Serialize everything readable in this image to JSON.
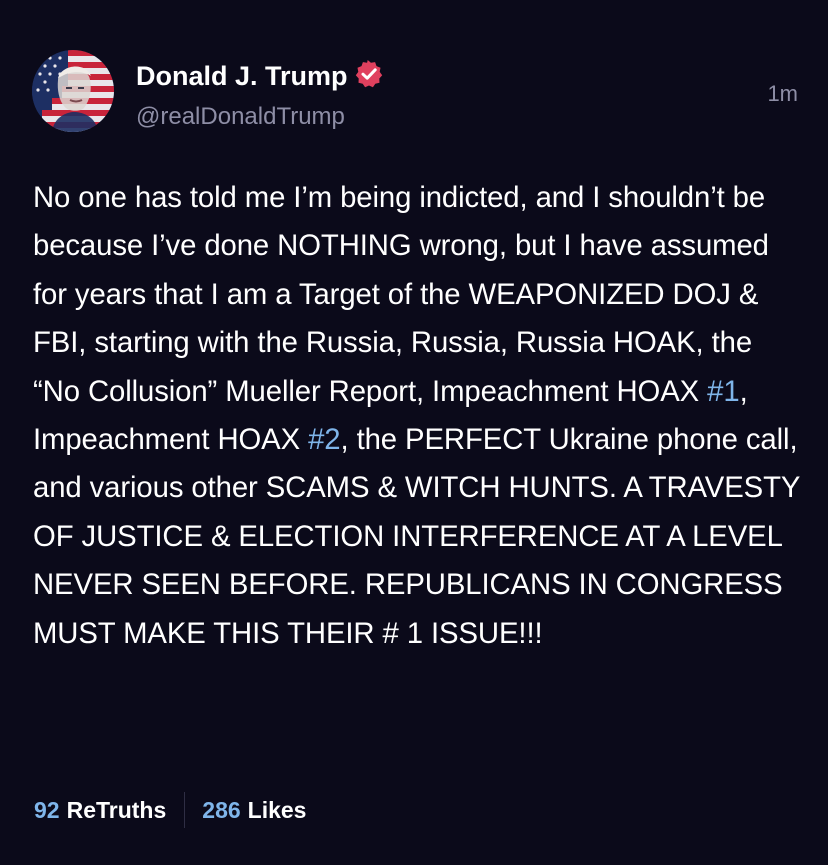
{
  "author": {
    "display_name": "Donald J. Trump",
    "handle": "@realDonaldTrump",
    "avatar_icon": "avatar-flag-portrait-icon",
    "verified_icon": "verified-badge-icon",
    "verified_color": "#e0405e"
  },
  "timestamp": "1m",
  "post": {
    "segments": [
      {
        "text": "No one has told me I’m being indicted, and I shouldn’t be because I’ve done NOTHING wrong, but I have assumed for years that I am a Target of the WEAPONIZED DOJ & FBI, starting with the Russia, Russia, Russia HOAK, the “No Collusion” Mueller Report, Impeachment HOAX ",
        "type": "text"
      },
      {
        "text": "#1",
        "type": "hashtag"
      },
      {
        "text": ", Impeachment HOAX ",
        "type": "text"
      },
      {
        "text": "#2",
        "type": "hashtag"
      },
      {
        "text": ", the PERFECT Ukraine phone call, and various other SCAMS & WITCH HUNTS. A TRAVESTY OF JUSTICE & ELECTION INTERFERENCE AT A LEVEL NEVER SEEN BEFORE. REPUBLICANS IN CONGRESS MUST MAKE THIS THEIR # 1 ISSUE!!!",
        "type": "text"
      }
    ]
  },
  "stats": {
    "retruths_count": "92",
    "retruths_label": "ReTruths",
    "likes_count": "286",
    "likes_label": "Likes"
  },
  "colors": {
    "background": "#0b0a1a",
    "text": "#ffffff",
    "muted": "#8e8ea6",
    "hashtag": "#7fb5ea"
  }
}
